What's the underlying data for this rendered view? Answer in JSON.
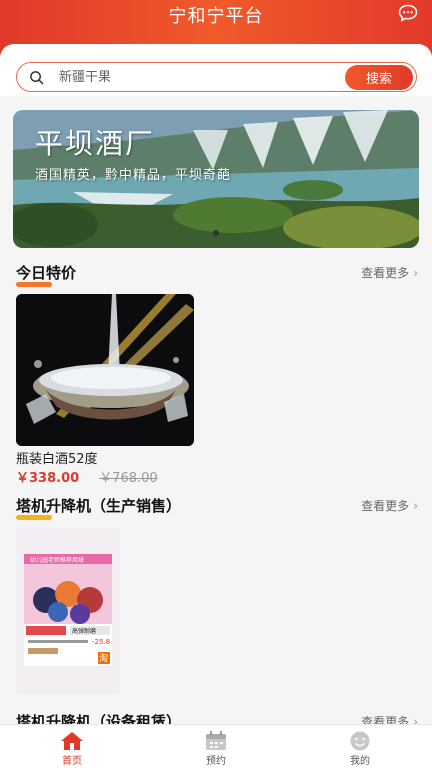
{
  "header": {
    "title": "宁和宁平台"
  },
  "search": {
    "placeholder": "新疆干果",
    "button_label": "搜索"
  },
  "banner": {
    "title": "平坝酒厂",
    "subtitle": "酒国精英，黔中精品，平坝奇葩"
  },
  "sections": [
    {
      "title": "今日特价",
      "more_label": "查看更多",
      "accent": "#f07a2a",
      "products": [
        {
          "name": "瓶装白酒52度",
          "price": "￥338.00",
          "original_price": "￥768.00"
        }
      ]
    },
    {
      "title": "塔机升降机（生产销售）",
      "more_label": "查看更多",
      "accent": "#f5b21a",
      "products": [
        {
          "image_text_top": "幼儿园老师推荐用球",
          "image_text_a": "高弹耐磨",
          "image_price": "-25.8",
          "image_badge": "淘"
        }
      ]
    },
    {
      "title": "塔机升降机（设备租赁）",
      "more_label": "查看更多"
    }
  ],
  "tabbar": [
    {
      "label": "首页",
      "icon": "home-icon",
      "active": true
    },
    {
      "label": "预约",
      "icon": "calendar-icon",
      "active": false
    },
    {
      "label": "我的",
      "icon": "user-face-icon",
      "active": false
    }
  ],
  "colors": {
    "brand": "#e0392a",
    "price": "#e0392a"
  }
}
